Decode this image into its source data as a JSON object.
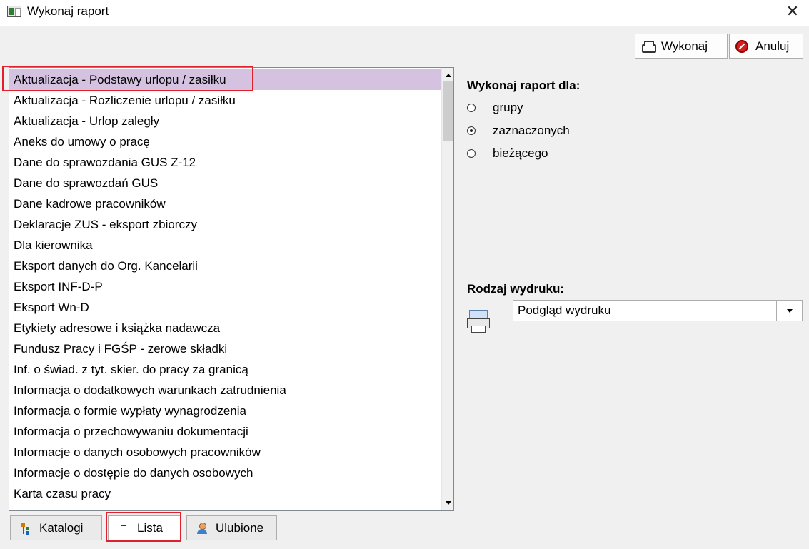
{
  "window": {
    "title": "Wykonaj raport",
    "close_symbol": "✕"
  },
  "toolbar": {
    "execute_label": "Wykonaj",
    "cancel_label": "Anuluj",
    "execute_icon": "printer-icon",
    "cancel_icon": "cancel-icon"
  },
  "report_list": {
    "items": [
      "Aktualizacja - Podstawy urlopu / zasiłku",
      "Aktualizacja - Rozliczenie urlopu / zasiłku",
      "Aktualizacja - Urlop zaległy",
      "Aneks do umowy o pracę",
      "Dane do sprawozdania GUS Z-12",
      "Dane do sprawozdań GUS",
      "Dane kadrowe pracowników",
      "Deklaracje ZUS - eksport zbiorczy",
      "Dla kierownika",
      "Eksport danych do Org. Kancelarii",
      "Eksport INF-D-P",
      "Eksport Wn-D",
      "Etykiety adresowe i książka nadawcza",
      "Fundusz Pracy i FGŚP - zerowe składki",
      "Inf. o świad. z tyt. skier. do pracy za granicą",
      "Informacja o dodatkowych warunkach zatrudnienia",
      "Informacja o formie wypłaty wynagrodzenia",
      "Informacja o przechowywaniu dokumentacji",
      "Informacje o danych osobowych pracowników",
      "Informacje o dostępie do danych osobowych",
      "Karta czasu pracy"
    ],
    "selected_index": 0,
    "selected_color": "#d5c2e0"
  },
  "tabs": [
    {
      "label": "Katalogi",
      "icon": "tree-icon",
      "active": false
    },
    {
      "label": "Lista",
      "icon": "document-icon",
      "active": true
    },
    {
      "label": "Ulubione",
      "icon": "user-icon",
      "active": false
    }
  ],
  "report_for": {
    "heading": "Wykonaj raport dla:",
    "options": [
      {
        "label": "grupy",
        "checked": false
      },
      {
        "label": "zaznaczonych",
        "checked": true
      },
      {
        "label": "bieżącego",
        "checked": false
      }
    ]
  },
  "print_type": {
    "heading": "Rodzaj wydruku:",
    "selected": "Podgląd wydruku",
    "icon": "print-preview-icon"
  },
  "colors": {
    "highlight_border": "#e0202a",
    "background": "#f0f0f0"
  }
}
